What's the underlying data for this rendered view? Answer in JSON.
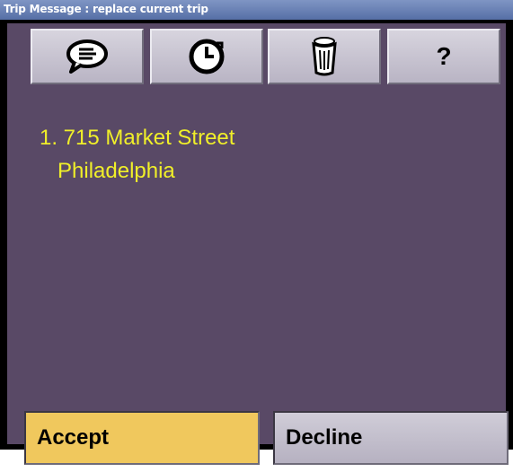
{
  "window": {
    "title": "Trip Message : replace current trip"
  },
  "toolbar": {
    "buttons": [
      {
        "icon": "speech-bubble-icon"
      },
      {
        "icon": "clock-history-icon"
      },
      {
        "icon": "trash-icon"
      },
      {
        "icon": "help-icon",
        "label": "?"
      }
    ]
  },
  "trip": {
    "stops": [
      {
        "line1": "1. 715 Market Street",
        "line2": "Philadelphia"
      }
    ]
  },
  "actions": {
    "accept_label": "Accept",
    "decline_label": "Decline"
  },
  "colors": {
    "background": "#594966",
    "address_text": "#f0ef29",
    "accept_bg": "#f0c85d"
  }
}
